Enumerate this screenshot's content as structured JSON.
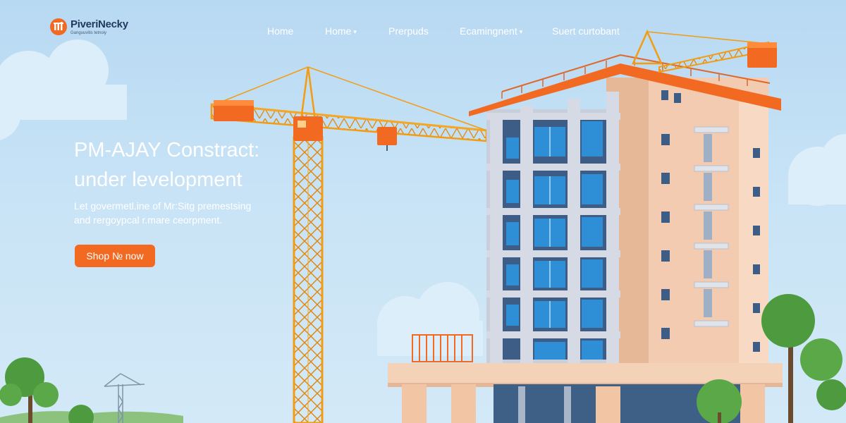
{
  "brand": {
    "name": "PiveriNecky",
    "tagline": "Ganguuvitis tetnoiy",
    "accent_color": "#f26a21"
  },
  "nav": {
    "items": [
      {
        "label": "Home",
        "has_dropdown": false
      },
      {
        "label": "Home",
        "has_dropdown": true
      },
      {
        "label": "Prerpuds",
        "has_dropdown": false
      },
      {
        "label": "Ecamingnent",
        "has_dropdown": true
      },
      {
        "label": "Suert curtobant",
        "has_dropdown": false
      }
    ],
    "dropdown_icon": "chevron-down-icon"
  },
  "hero": {
    "title_line1": "PM-AJAY Constract:",
    "title_line2": "under levelopment",
    "subtitle_line1": "Let govermetl.ine of Mr:Sitg premestsing",
    "subtitle_line2": "and rergoypcal r.mare ceorpment.",
    "cta_label": "Shop № now"
  },
  "illustration": {
    "subject": "construction-scene",
    "colors": {
      "sky": "#c3e0f5",
      "crane": "#f5a623",
      "building_facade": "#f2cbb0",
      "building_frame": "#c7ccd9",
      "windows": "#2f8fd6",
      "roof_trim": "#f26a21",
      "trees": "#4e9a3e"
    }
  }
}
